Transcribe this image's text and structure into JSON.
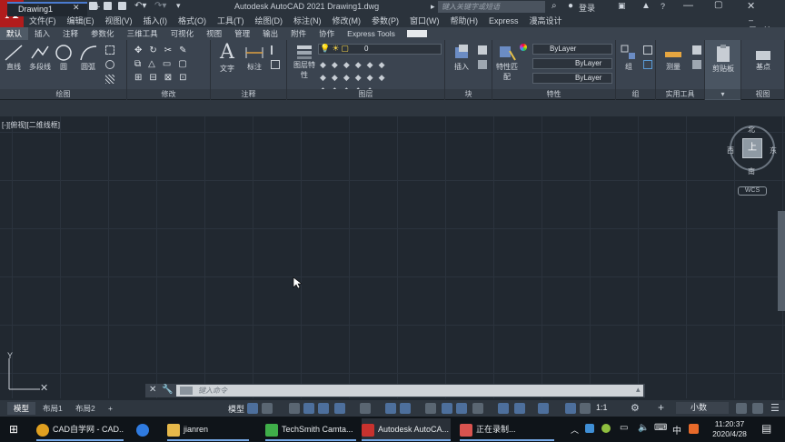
{
  "app": {
    "logo_letter": "A",
    "title": "Autodesk AutoCAD 2021    Drawing1.dwg",
    "search_placeholder": "键入关键字或短语",
    "sign_in": "登录",
    "help": "?"
  },
  "menubar": [
    "文件(F)",
    "编辑(E)",
    "视图(V)",
    "插入(I)",
    "格式(O)",
    "工具(T)",
    "绘图(D)",
    "标注(N)",
    "修改(M)",
    "参数(P)",
    "窗口(W)",
    "帮助(H)",
    "Express",
    "漫高设计"
  ],
  "ribbon_tabs": [
    "默认",
    "插入",
    "注释",
    "参数化",
    "三维工具",
    "可视化",
    "视图",
    "管理",
    "输出",
    "附件",
    "协作",
    "Express Tools"
  ],
  "ribbon_active_tab": "默认",
  "panels": {
    "draw": {
      "title": "绘图",
      "line": "直线",
      "polyline": "多段线",
      "circle": "圆",
      "arc": "圆弧"
    },
    "modify": {
      "title": "修改"
    },
    "annotation": {
      "title": "注释",
      "text": "文字",
      "dimension": "标注"
    },
    "layers": {
      "title": "图层",
      "layer_props": "图层特性",
      "current_layer": "0"
    },
    "block": {
      "title": "块",
      "insert": "插入"
    },
    "properties": {
      "title": "特性",
      "match": "特性匹配",
      "color": "ByLayer",
      "linetype": "ByLayer",
      "lineweight": "ByLayer"
    },
    "groups": {
      "title": "组",
      "group": "组"
    },
    "utilities": {
      "title": "实用工具",
      "measure": "测量"
    },
    "clipboard": {
      "title": "",
      "paste": "剪贴板"
    },
    "view": {
      "title": "视图",
      "base": "基点"
    }
  },
  "document_tab": "Drawing1",
  "viewport_label": "[-][俯视][二维线框]",
  "viewcube": {
    "face": "上",
    "north": "北",
    "south": "南",
    "east": "东",
    "west": "西",
    "wcs": "WCS"
  },
  "command_placeholder": "键入命令",
  "layout_tabs": [
    "模型",
    "布局1",
    "布局2"
  ],
  "status": {
    "model": "模型",
    "scale": "1:1",
    "units": "小数"
  },
  "taskbar": {
    "apps": [
      {
        "label": "CAD自学网 - CAD...",
        "color": "#e0a020"
      },
      {
        "label": "",
        "color": "#2f7be0"
      },
      {
        "label": "jianren",
        "color": "#e6b84a"
      },
      {
        "label": "TechSmith Camta...",
        "color": "#3fae49"
      },
      {
        "label": "Autodesk AutoCA...",
        "color": "#c8322e"
      },
      {
        "label": "正在录制...",
        "color": "#d9534f"
      }
    ],
    "time": "11:20:37",
    "date": "2020/4/28",
    "ime": "中"
  }
}
